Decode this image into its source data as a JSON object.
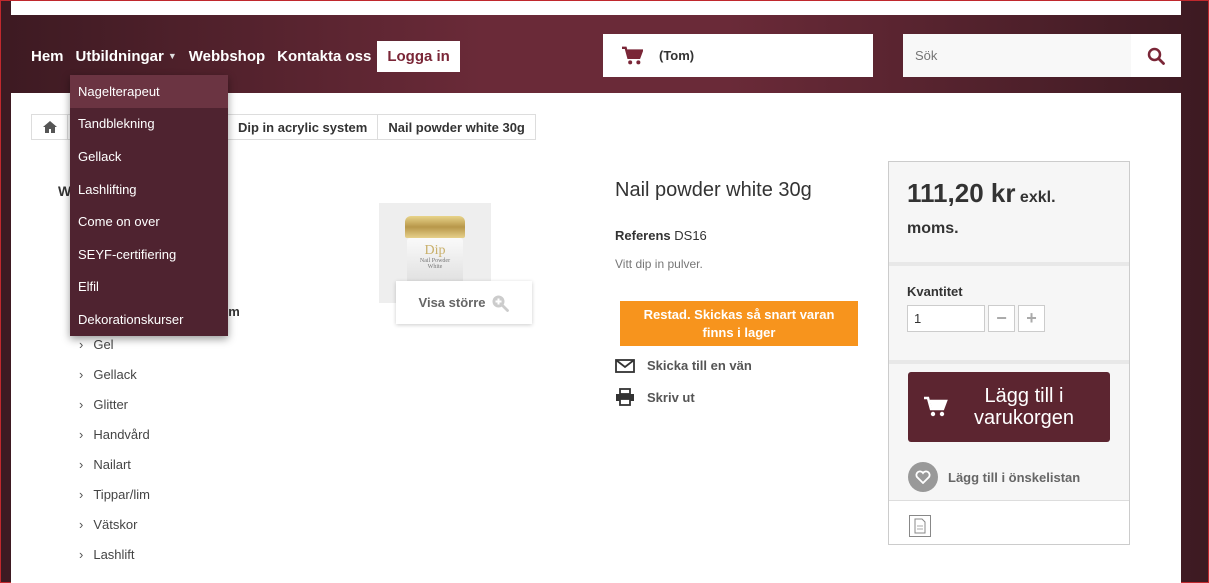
{
  "nav": {
    "items": [
      {
        "label": "Hem"
      },
      {
        "label": "Utbildningar",
        "has_caret": true
      },
      {
        "label": "Webbshop"
      },
      {
        "label": "Kontakta oss"
      }
    ],
    "login_label": "Logga in"
  },
  "dropdown": {
    "items": [
      "Nagelterapeut",
      "Tandblekning",
      "Gellack",
      "Lashlifting",
      "Come on over",
      "SEYF-certifiering",
      "Elfil",
      "Dekorationskurser"
    ],
    "active_index": 0
  },
  "cart": {
    "label": "(Tom)",
    "icon": "shopping-cart-icon"
  },
  "search": {
    "placeholder": "Sök",
    "icon": "search-icon"
  },
  "breadcrumb": {
    "items": [
      "Dip in acrylic system",
      "Nail powder white 30g"
    ],
    "home_icon": "home-icon"
  },
  "categories": {
    "heading_fragment": "W",
    "partial_item": "em",
    "items": [
      "Gel",
      "Gellack",
      "Glitter",
      "Handvård",
      "Nailart",
      "Tippar/lim",
      "Vätskor",
      "Lashlift"
    ]
  },
  "product": {
    "image_text_top": "Dip",
    "image_text_line1": "Nail Powder",
    "image_text_line2": "White",
    "zoom_label": "Visa större",
    "title": "Nail powder white 30g",
    "reference_label": "Referens",
    "reference_value": "DS16",
    "description": "Vitt dip in pulver.",
    "availability": "Restad. Skickas så snart varan finns i lager",
    "send_to_friend": "Skicka till en vän",
    "print": "Skriv ut"
  },
  "buy_box": {
    "price": "111,20 kr",
    "price_suffix_1": "exkl.",
    "price_suffix_2": "moms.",
    "quantity_label": "Kvantitet",
    "quantity_value": "1",
    "minus": "−",
    "plus": "+",
    "add_to_cart": "Lägg till i varukorgen",
    "wishlist": "Lägg till i önskelistan"
  },
  "colors": {
    "brand": "#5c2530",
    "accent_link": "#7a2637",
    "availability_bg": "#f7941d"
  }
}
